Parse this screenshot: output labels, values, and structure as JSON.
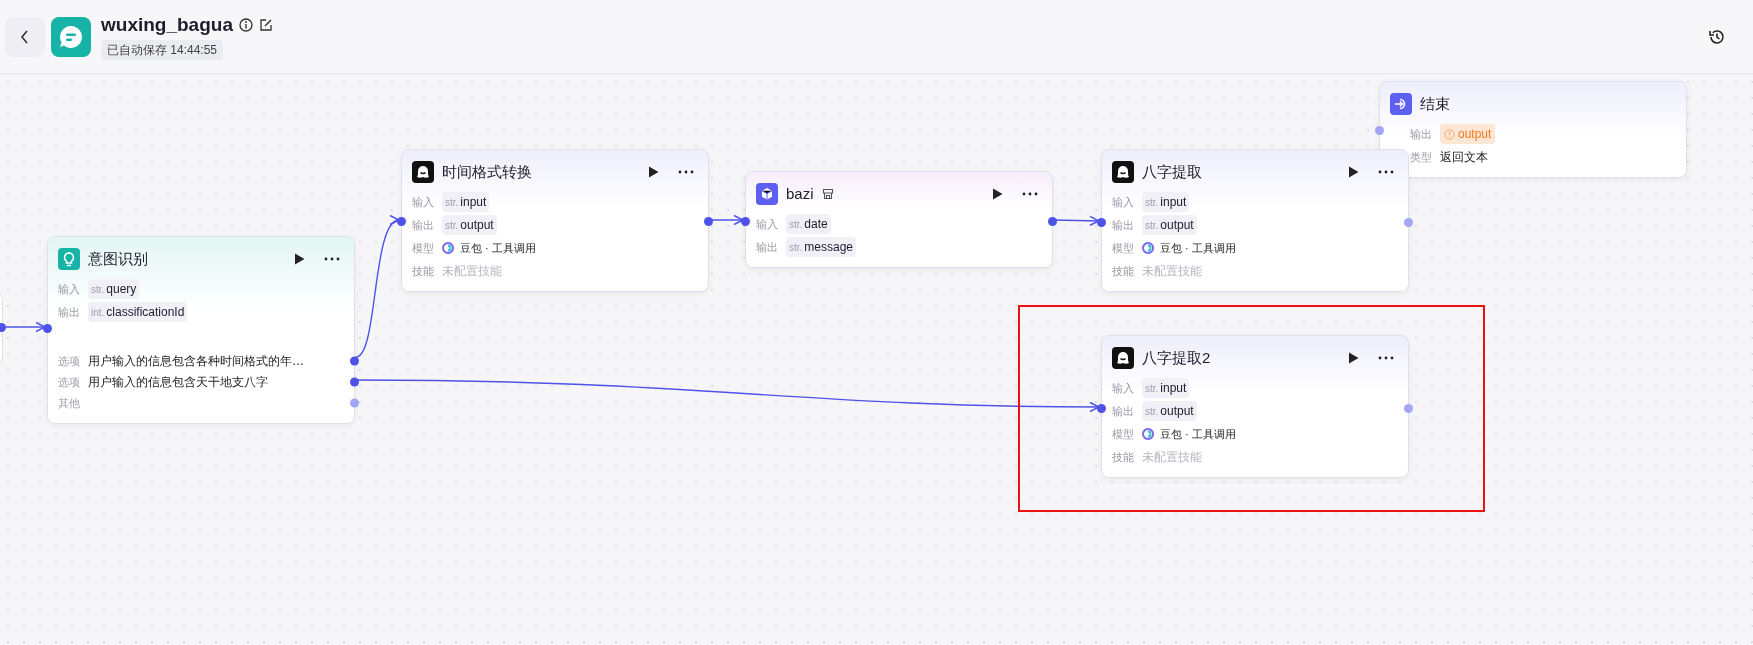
{
  "header": {
    "title": "wuxing_bagua",
    "autosave": "已自动保存 14:44:55"
  },
  "nodes": [
    {
      "kind": "intent",
      "title": "意图识别",
      "actions": true,
      "highlighted": false,
      "input_connected": true,
      "rows": [
        {
          "kind": "param",
          "label": "输入",
          "type": "str.",
          "name": "query"
        },
        {
          "kind": "param",
          "label": "输出",
          "type": "int.",
          "name": "classificationId"
        }
      ],
      "options": [
        {
          "label": "选项",
          "text": "用户输入的信息包含各种时间格式的年…",
          "connected": true
        },
        {
          "label": "选项",
          "text": "用户输入的信息包含天干地支八字",
          "connected": true
        },
        {
          "label": "其他",
          "connected": false
        }
      ]
    },
    {
      "kind": "llm",
      "title": "时间格式转换",
      "actions": true,
      "highlighted": false,
      "input_connected": true,
      "output_connected": true,
      "rows": [
        {
          "kind": "param",
          "label": "输入",
          "type": "str.",
          "name": "input"
        },
        {
          "kind": "param",
          "label": "输出",
          "type": "str.",
          "name": "output"
        },
        {
          "kind": "model",
          "label": "模型",
          "text": "豆包 · 工具调用"
        },
        {
          "kind": "muted",
          "label": "技能",
          "text": "未配置技能"
        }
      ]
    },
    {
      "kind": "plugin",
      "title": "bazi",
      "actions": true,
      "highlighted": false,
      "input_connected": true,
      "output_connected": true,
      "rows": [
        {
          "kind": "param",
          "label": "输入",
          "type": "str.",
          "name": "date"
        },
        {
          "kind": "param",
          "label": "输出",
          "type": "str.",
          "name": "message"
        }
      ]
    },
    {
      "kind": "llm",
      "title": "八字提取",
      "actions": true,
      "highlighted": false,
      "input_connected": true,
      "output_connected": false,
      "rows": [
        {
          "kind": "param",
          "label": "输入",
          "type": "str.",
          "name": "input"
        },
        {
          "kind": "param",
          "label": "输出",
          "type": "str.",
          "name": "output"
        },
        {
          "kind": "model",
          "label": "模型",
          "text": "豆包 · 工具调用"
        },
        {
          "kind": "muted",
          "label": "技能",
          "text": "未配置技能"
        }
      ]
    },
    {
      "kind": "end",
      "title": "结束",
      "actions": false,
      "highlighted": false,
      "input_connected": false,
      "rows": [
        {
          "kind": "warn-param",
          "label": "输出",
          "name": "output"
        },
        {
          "kind": "text",
          "label": "类型",
          "text": "返回文本"
        }
      ]
    },
    {
      "kind": "llm",
      "title": "八字提取2",
      "actions": true,
      "highlighted": true,
      "input_connected": true,
      "output_connected": false,
      "rows": [
        {
          "kind": "param",
          "label": "输入",
          "type": "str.",
          "name": "input"
        },
        {
          "kind": "param",
          "label": "输出",
          "type": "str.",
          "name": "output"
        },
        {
          "kind": "model",
          "label": "模型",
          "text": "豆包 · 工具调用"
        },
        {
          "kind": "muted",
          "label": "技能",
          "text": "未配置技能"
        }
      ]
    }
  ]
}
